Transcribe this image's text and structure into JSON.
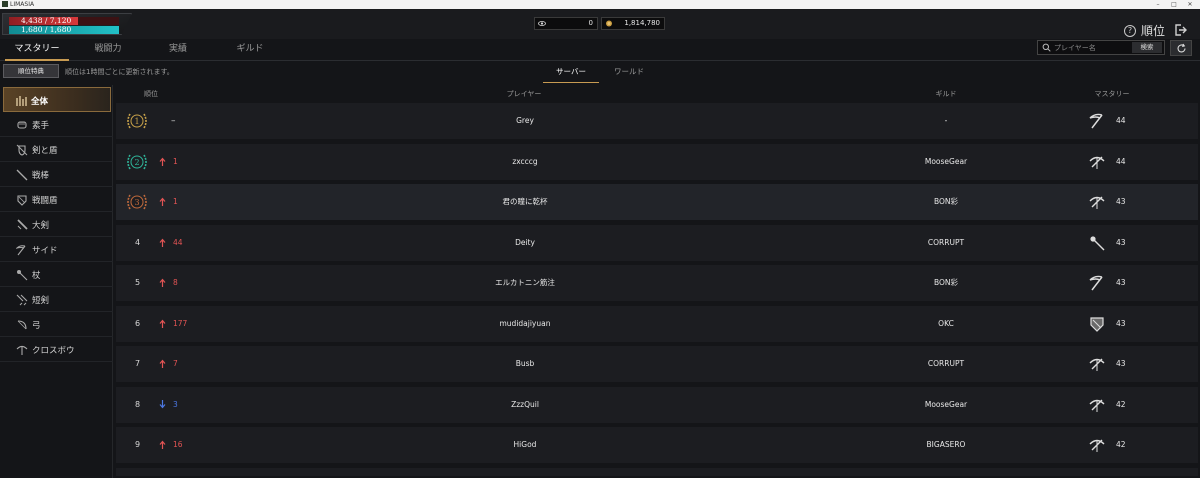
{
  "window": {
    "title": "LIMASIA"
  },
  "status": {
    "hp_text": "4,438 / 7,120",
    "hp_fraction": 0.623,
    "mp_text": "1,680 / 1,680",
    "mp_fraction": 1.0
  },
  "currency": {
    "stones": "0",
    "gold": "1,814,780"
  },
  "header": {
    "title": "順位"
  },
  "tabs": [
    {
      "label": "マスタリー",
      "active": true
    },
    {
      "label": "戦闘力",
      "active": false
    },
    {
      "label": "実績",
      "active": false
    },
    {
      "label": "ギルド",
      "active": false
    }
  ],
  "search": {
    "placeholder": "プレイヤー名",
    "button_label": "検索"
  },
  "perk_button": "順位特典",
  "update_notice": "順位は1時間ごとに更新されます。",
  "sub_tabs": [
    {
      "label": "サーバー",
      "active": true
    },
    {
      "label": "ワールド",
      "active": false
    }
  ],
  "sidebar": {
    "items": [
      {
        "label": "全体",
        "icon": "all-weapons-icon",
        "active": true
      },
      {
        "label": "素手",
        "icon": "fist-icon"
      },
      {
        "label": "剣と盾",
        "icon": "sword-shield-icon"
      },
      {
        "label": "戦棒",
        "icon": "staff-icon"
      },
      {
        "label": "戦闘盾",
        "icon": "battle-shield-icon"
      },
      {
        "label": "大剣",
        "icon": "greatsword-icon"
      },
      {
        "label": "サイド",
        "icon": "scythe-icon"
      },
      {
        "label": "杖",
        "icon": "wand-icon"
      },
      {
        "label": "短剣",
        "icon": "dagger-icon"
      },
      {
        "label": "弓",
        "icon": "bow-icon"
      },
      {
        "label": "クロスボウ",
        "icon": "crossbow-icon"
      }
    ]
  },
  "columns": {
    "rank": "順位",
    "player": "プレイヤー",
    "guild": "ギルド",
    "mastery": "マスタリー"
  },
  "colors": {
    "accent": "#c89b52",
    "up": "#e25454",
    "down": "#4c78e3",
    "gold_medal": "#c8a24a",
    "silver_medal": "#2fb59a",
    "bronze_medal": "#c06a3c"
  },
  "rows": [
    {
      "rank": "1",
      "change": "–",
      "direction": "none",
      "player": "Grey",
      "guild": "-",
      "weapon": "scythe-icon",
      "mastery": "44"
    },
    {
      "rank": "2",
      "change": "1",
      "direction": "up",
      "player": "zxcccg",
      "guild": "MooseGear",
      "weapon": "crossbow-icon",
      "mastery": "44"
    },
    {
      "rank": "3",
      "change": "1",
      "direction": "up",
      "player": "君の瞳に乾杯",
      "guild": "BON彩",
      "weapon": "crossbow-icon",
      "mastery": "43"
    },
    {
      "rank": "4",
      "change": "44",
      "direction": "up",
      "player": "Deity",
      "guild": "CORRUPT",
      "weapon": "wand-icon",
      "mastery": "43"
    },
    {
      "rank": "5",
      "change": "8",
      "direction": "up",
      "player": "エルカトニン筋注",
      "guild": "BON彩",
      "weapon": "scythe-icon",
      "mastery": "43"
    },
    {
      "rank": "6",
      "change": "177",
      "direction": "up",
      "player": "mudidajiyuan",
      "guild": "OKC",
      "weapon": "battle-shield-icon",
      "mastery": "43"
    },
    {
      "rank": "7",
      "change": "7",
      "direction": "up",
      "player": "Busb",
      "guild": "CORRUPT",
      "weapon": "crossbow-icon",
      "mastery": "43"
    },
    {
      "rank": "8",
      "change": "3",
      "direction": "down",
      "player": "ZzzQuil",
      "guild": "MooseGear",
      "weapon": "crossbow-icon",
      "mastery": "42"
    },
    {
      "rank": "9",
      "change": "16",
      "direction": "up",
      "player": "HiGod",
      "guild": "BIGASERO",
      "weapon": "crossbow-icon",
      "mastery": "42"
    }
  ]
}
